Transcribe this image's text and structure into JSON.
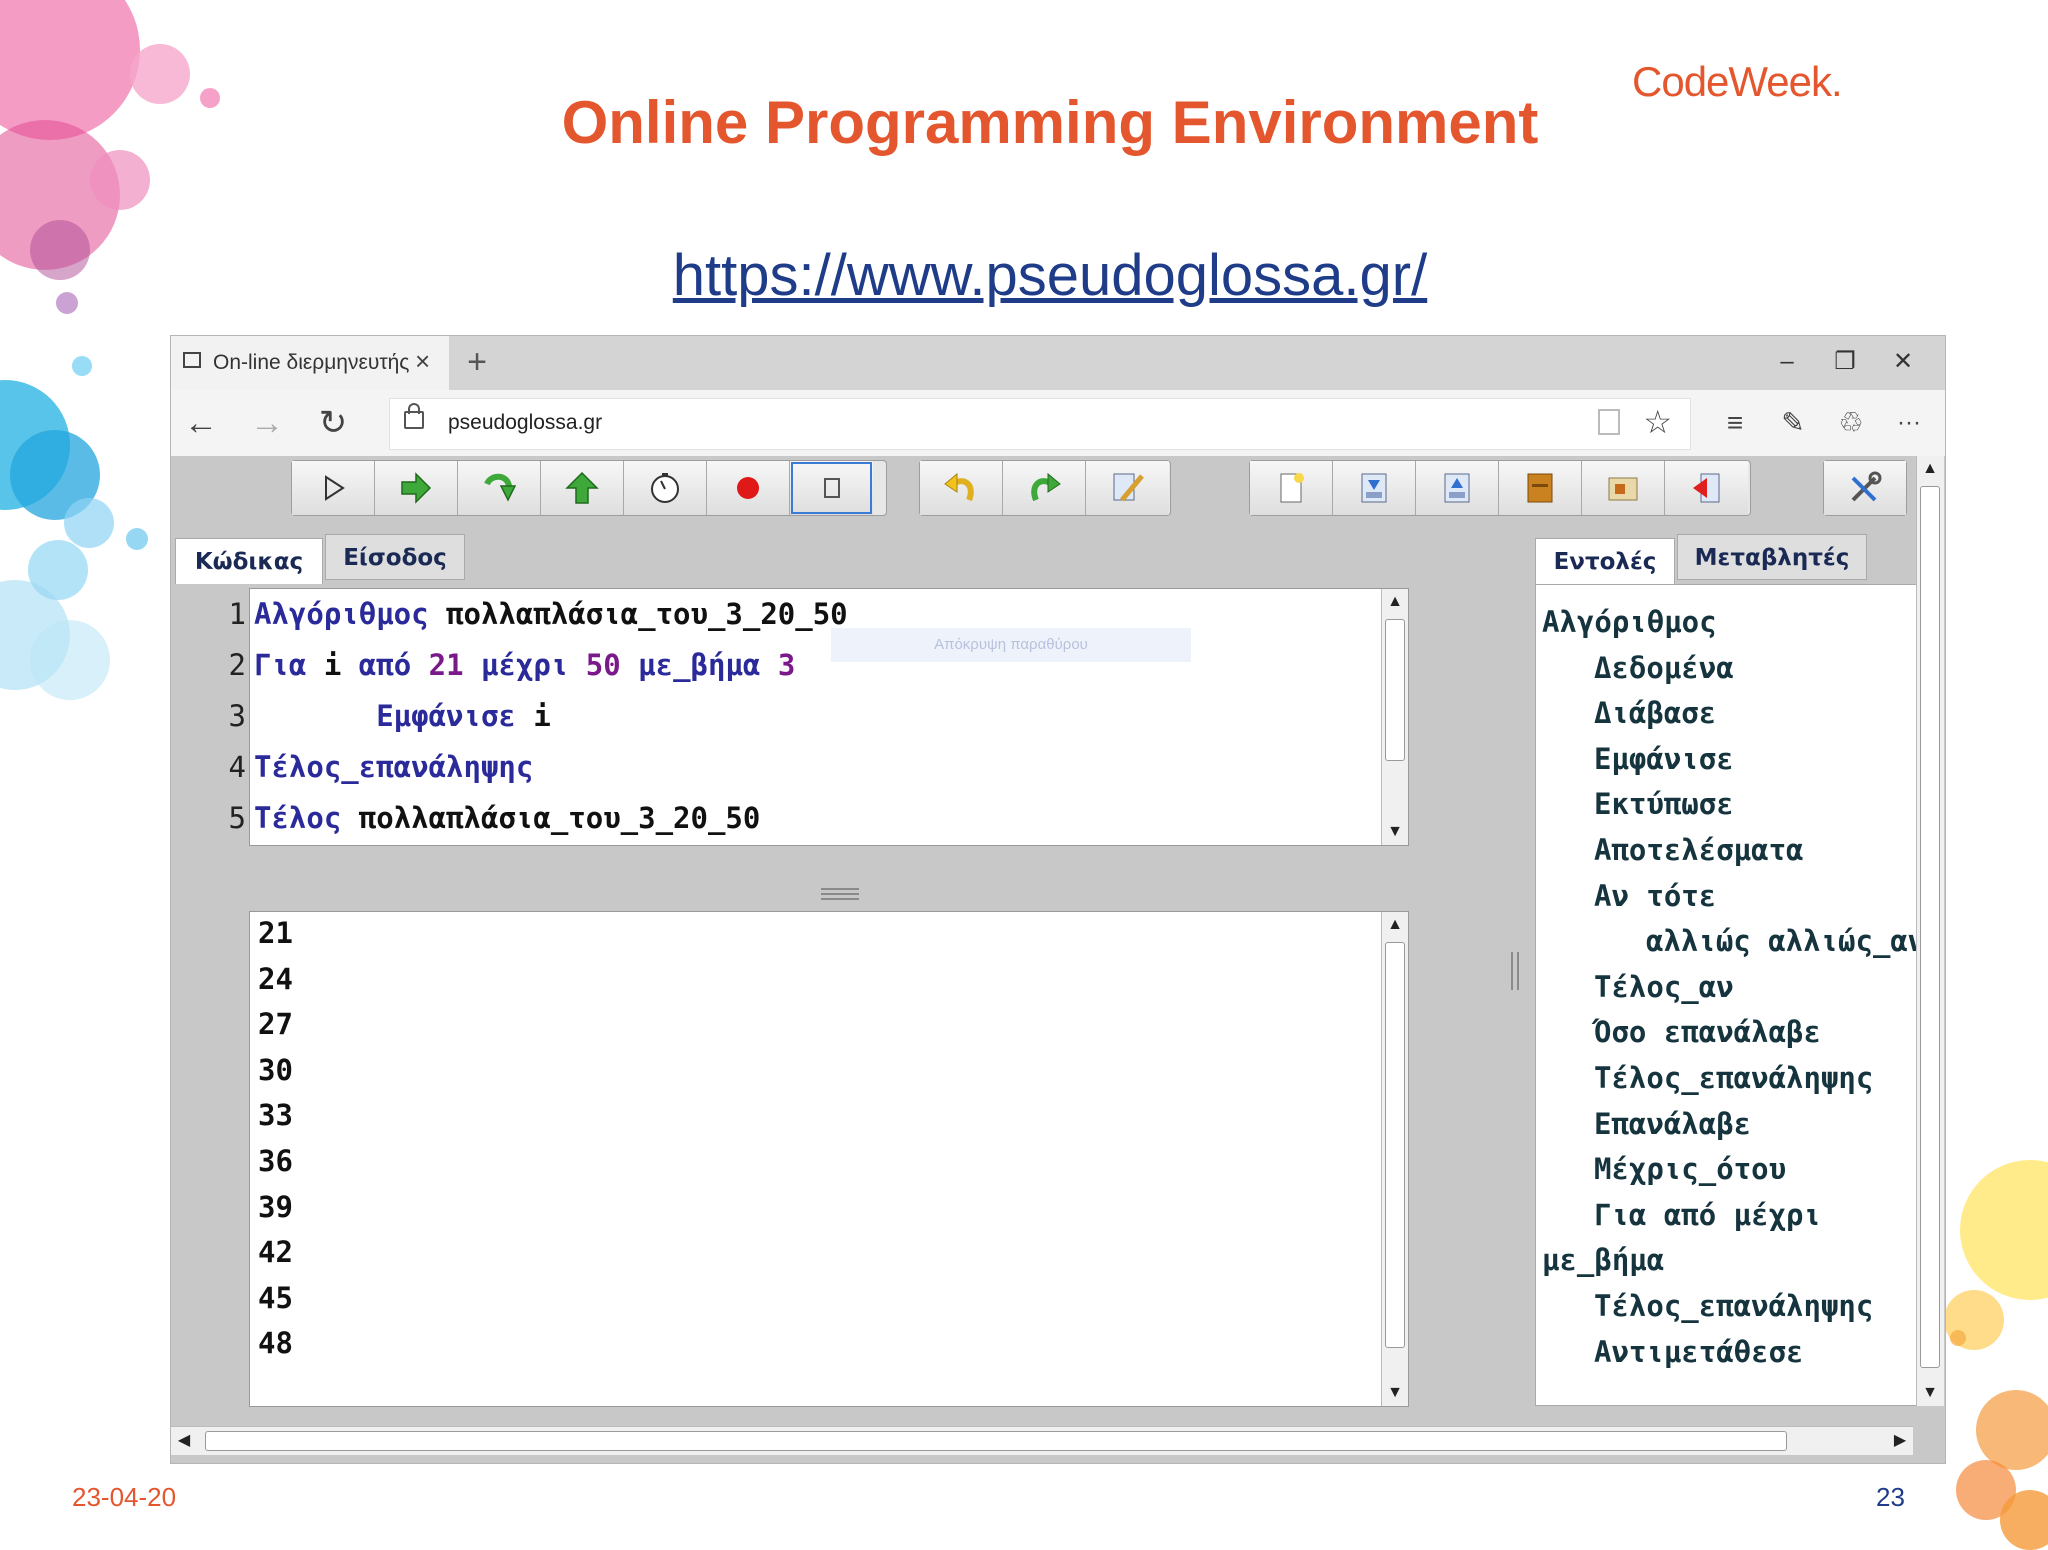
{
  "slide": {
    "title": "Online Programming Environment",
    "url": "https://www.pseudoglossa.gr/",
    "logo": "CodeWeek.",
    "footer_date": "23-04-20",
    "page_number": "23"
  },
  "browser": {
    "tab_title": "On-line διερμηνευτής γ",
    "new_tab": "+",
    "close_tab": "×",
    "address": "pseudoglossa.gr",
    "window_controls": {
      "minimize": "–",
      "restore": "❐",
      "close": "✕"
    },
    "nav": {
      "back": "←",
      "forward": "→",
      "refresh": "↻"
    },
    "more": "···"
  },
  "app": {
    "toolbar_icons": [
      [
        "run-icon",
        "step-over-icon",
        "step-into-icon",
        "step-out-icon",
        "timer-icon",
        "stop-icon",
        "clear-icon"
      ],
      [
        "undo-icon",
        "redo-icon",
        "edit-icon"
      ],
      [
        "new-file-icon",
        "open-icon",
        "save-icon",
        "archive-icon",
        "settings-file-icon",
        "exit-icon"
      ],
      [
        "tools-icon"
      ]
    ],
    "left_tabs": {
      "code": "Κώδικας",
      "input": "Είσοδος"
    },
    "right_tabs": {
      "commands": "Εντολές",
      "variables": "Μεταβλητές"
    },
    "tooltip": "Απόκρυψη παραθύρου",
    "code_lines": [
      {
        "n": "1",
        "tokens": [
          {
            "t": "Αλγόριθμος",
            "c": "kw"
          },
          {
            "t": " πολλαπλάσια_του_3_20_50",
            "c": "tx"
          }
        ]
      },
      {
        "n": "2",
        "tokens": [
          {
            "t": "Για",
            "c": "kw"
          },
          {
            "t": " i ",
            "c": "tx"
          },
          {
            "t": "από",
            "c": "kw"
          },
          {
            "t": " 21 ",
            "c": "nm"
          },
          {
            "t": "μέχρι",
            "c": "kw"
          },
          {
            "t": " 50 ",
            "c": "nm"
          },
          {
            "t": "με_βήμα",
            "c": "kw"
          },
          {
            "t": " 3",
            "c": "nm"
          }
        ]
      },
      {
        "n": "3",
        "tokens": [
          {
            "t": "       Εμφάνισε",
            "c": "kw"
          },
          {
            "t": " i",
            "c": "tx"
          }
        ]
      },
      {
        "n": "4",
        "tokens": [
          {
            "t": "Τέλος_επανάληψης",
            "c": "kw"
          }
        ]
      },
      {
        "n": "5",
        "tokens": [
          {
            "t": "Τέλος",
            "c": "kw"
          },
          {
            "t": " πολλαπλάσια_του_3_20_50",
            "c": "tx"
          }
        ]
      }
    ],
    "output": [
      "21",
      "24",
      "27",
      "30",
      "33",
      "36",
      "39",
      "42",
      "45",
      "48"
    ],
    "commands": [
      {
        "text": "Αλγόριθμος",
        "indent": 0
      },
      {
        "text": "Δεδομένα",
        "indent": 1
      },
      {
        "text": "Διάβασε",
        "indent": 1
      },
      {
        "text": "Εμφάνισε",
        "indent": 1
      },
      {
        "text": "Εκτύπωσε",
        "indent": 1
      },
      {
        "text": "Αποτελέσματα",
        "indent": 1
      },
      {
        "text": "Αν τότε",
        "indent": 1
      },
      {
        "text": "αλλιώς αλλιώς_αν",
        "indent": 2
      },
      {
        "text": "Τέλος_αν",
        "indent": 1
      },
      {
        "text": "Όσο επανάλαβε",
        "indent": 1
      },
      {
        "text": "Τέλος_επανάληψης",
        "indent": 1
      },
      {
        "text": "Επανάλαβε",
        "indent": 1
      },
      {
        "text": "Μέχρις_ότου",
        "indent": 1
      },
      {
        "text": "Για από μέχρι",
        "indent": 1
      },
      {
        "text": "με_βήμα",
        "indent": 0
      },
      {
        "text": "Τέλος_επανάληψης",
        "indent": 1
      },
      {
        "text": "Αντιμετάθεσε",
        "indent": 1
      }
    ]
  },
  "colors": {
    "title": "#e4572e",
    "link": "#1f3c88",
    "keyword": "#2a2a9a",
    "number": "#7a1a8a"
  }
}
